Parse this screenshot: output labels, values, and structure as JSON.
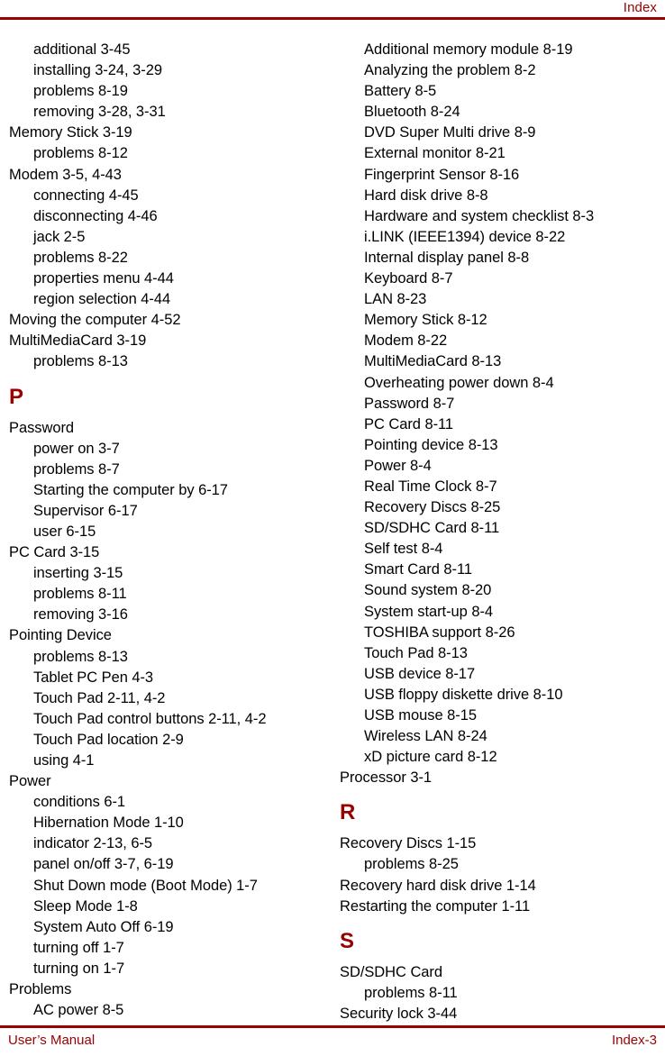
{
  "header": {
    "title": "Index"
  },
  "footer": {
    "left_label": "User’s Manual",
    "right_label": "Index-3"
  },
  "colors": {
    "accent": "#990000",
    "text": "#000000",
    "background": "#ffffff"
  },
  "columns": [
    {
      "name": "left-column",
      "blocks": [
        {
          "type": "entries",
          "items": [
            {
              "text": "additional 3-45",
              "level": 1
            },
            {
              "text": "installing 3-24, 3-29",
              "level": 1
            },
            {
              "text": "problems 8-19",
              "level": 1
            },
            {
              "text": "removing 3-28, 3-31",
              "level": 1
            },
            {
              "text": "Memory Stick 3-19",
              "level": 0
            },
            {
              "text": "problems 8-12",
              "level": 1
            },
            {
              "text": "Modem 3-5, 4-43",
              "level": 0
            },
            {
              "text": "connecting 4-45",
              "level": 1
            },
            {
              "text": "disconnecting 4-46",
              "level": 1
            },
            {
              "text": "jack 2-5",
              "level": 1
            },
            {
              "text": "problems 8-22",
              "level": 1
            },
            {
              "text": "properties menu 4-44",
              "level": 1
            },
            {
              "text": "region selection 4-44",
              "level": 1
            },
            {
              "text": "Moving the computer 4-52",
              "level": 0
            },
            {
              "text": "MultiMediaCard 3-19",
              "level": 0
            },
            {
              "text": "problems 8-13",
              "level": 1
            }
          ]
        },
        {
          "type": "section",
          "letter": "P"
        },
        {
          "type": "entries",
          "items": [
            {
              "text": "Password",
              "level": 0
            },
            {
              "text": "power on 3-7",
              "level": 1
            },
            {
              "text": "problems 8-7",
              "level": 1
            },
            {
              "text": "Starting the computer by 6-17",
              "level": 1
            },
            {
              "text": "Supervisor 6-17",
              "level": 1
            },
            {
              "text": "user 6-15",
              "level": 1
            },
            {
              "text": "PC Card 3-15",
              "level": 0
            },
            {
              "text": "inserting 3-15",
              "level": 1
            },
            {
              "text": "problems 8-11",
              "level": 1
            },
            {
              "text": "removing 3-16",
              "level": 1
            },
            {
              "text": "Pointing Device",
              "level": 0
            },
            {
              "text": "problems 8-13",
              "level": 1
            },
            {
              "text": "Tablet PC Pen 4-3",
              "level": 1
            },
            {
              "text": "Touch Pad 2-11, 4-2",
              "level": 1
            },
            {
              "text": "Touch Pad control buttons 2-11, 4-2",
              "level": 1
            },
            {
              "text": "Touch Pad location 2-9",
              "level": 1
            },
            {
              "text": "using 4-1",
              "level": 1
            },
            {
              "text": "Power",
              "level": 0
            },
            {
              "text": "conditions 6-1",
              "level": 1
            },
            {
              "text": "Hibernation Mode 1-10",
              "level": 1
            },
            {
              "text": "indicator 2-13, 6-5",
              "level": 1
            },
            {
              "text": "panel on/off 3-7, 6-19",
              "level": 1
            },
            {
              "text": "Shut Down mode (Boot Mode) 1-7",
              "level": 1
            },
            {
              "text": "Sleep Mode 1-8",
              "level": 1
            },
            {
              "text": "System Auto Off 6-19",
              "level": 1
            },
            {
              "text": "turning off 1-7",
              "level": 1
            },
            {
              "text": "turning on 1-7",
              "level": 1
            },
            {
              "text": "Problems",
              "level": 0
            },
            {
              "text": "AC power 8-5",
              "level": 1
            }
          ]
        }
      ]
    },
    {
      "name": "right-column",
      "blocks": [
        {
          "type": "entries",
          "items": [
            {
              "text": "Additional memory module 8-19",
              "level": 1
            },
            {
              "text": "Analyzing the problem 8-2",
              "level": 1
            },
            {
              "text": "Battery 8-5",
              "level": 1
            },
            {
              "text": "Bluetooth 8-24",
              "level": 1
            },
            {
              "text": "DVD Super Multi drive 8-9",
              "level": 1
            },
            {
              "text": "External monitor 8-21",
              "level": 1
            },
            {
              "text": "Fingerprint Sensor 8-16",
              "level": 1
            },
            {
              "text": "Hard disk drive 8-8",
              "level": 1
            },
            {
              "text": "Hardware and system checklist 8-3",
              "level": 1
            },
            {
              "text": "i.LINK (IEEE1394) device 8-22",
              "level": 1
            },
            {
              "text": "Internal display panel 8-8",
              "level": 1
            },
            {
              "text": "Keyboard 8-7",
              "level": 1
            },
            {
              "text": "LAN 8-23",
              "level": 1
            },
            {
              "text": "Memory Stick 8-12",
              "level": 1
            },
            {
              "text": "Modem 8-22",
              "level": 1
            },
            {
              "text": "MultiMediaCard 8-13",
              "level": 1
            },
            {
              "text": "Overheating power down 8-4",
              "level": 1
            },
            {
              "text": "Password 8-7",
              "level": 1
            },
            {
              "text": "PC Card 8-11",
              "level": 1
            },
            {
              "text": "Pointing device 8-13",
              "level": 1
            },
            {
              "text": "Power 8-4",
              "level": 1
            },
            {
              "text": "Real Time Clock 8-7",
              "level": 1
            },
            {
              "text": "Recovery Discs 8-25",
              "level": 1
            },
            {
              "text": "SD/SDHC Card 8-11",
              "level": 1
            },
            {
              "text": "Self test 8-4",
              "level": 1
            },
            {
              "text": "Smart Card 8-11",
              "level": 1
            },
            {
              "text": "Sound system 8-20",
              "level": 1
            },
            {
              "text": "System start-up 8-4",
              "level": 1
            },
            {
              "text": "TOSHIBA support 8-26",
              "level": 1
            },
            {
              "text": "Touch Pad 8-13",
              "level": 1
            },
            {
              "text": "USB device 8-17",
              "level": 1
            },
            {
              "text": "USB floppy diskette drive 8-10",
              "level": 1
            },
            {
              "text": "USB mouse 8-15",
              "level": 1
            },
            {
              "text": "Wireless LAN 8-24",
              "level": 1
            },
            {
              "text": "xD picture card 8-12",
              "level": 1
            },
            {
              "text": "Processor 3-1",
              "level": 0
            }
          ]
        },
        {
          "type": "section",
          "letter": "R"
        },
        {
          "type": "entries",
          "items": [
            {
              "text": "Recovery Discs 1-15",
              "level": 0
            },
            {
              "text": "problems 8-25",
              "level": 1
            },
            {
              "text": "Recovery hard disk drive 1-14",
              "level": 0
            },
            {
              "text": "Restarting the computer 1-11",
              "level": 0
            }
          ]
        },
        {
          "type": "section",
          "letter": "S"
        },
        {
          "type": "entries",
          "items": [
            {
              "text": "SD/SDHC Card",
              "level": 0
            },
            {
              "text": "problems 8-11",
              "level": 1
            },
            {
              "text": "Security lock 3-44",
              "level": 0
            }
          ]
        }
      ]
    }
  ]
}
